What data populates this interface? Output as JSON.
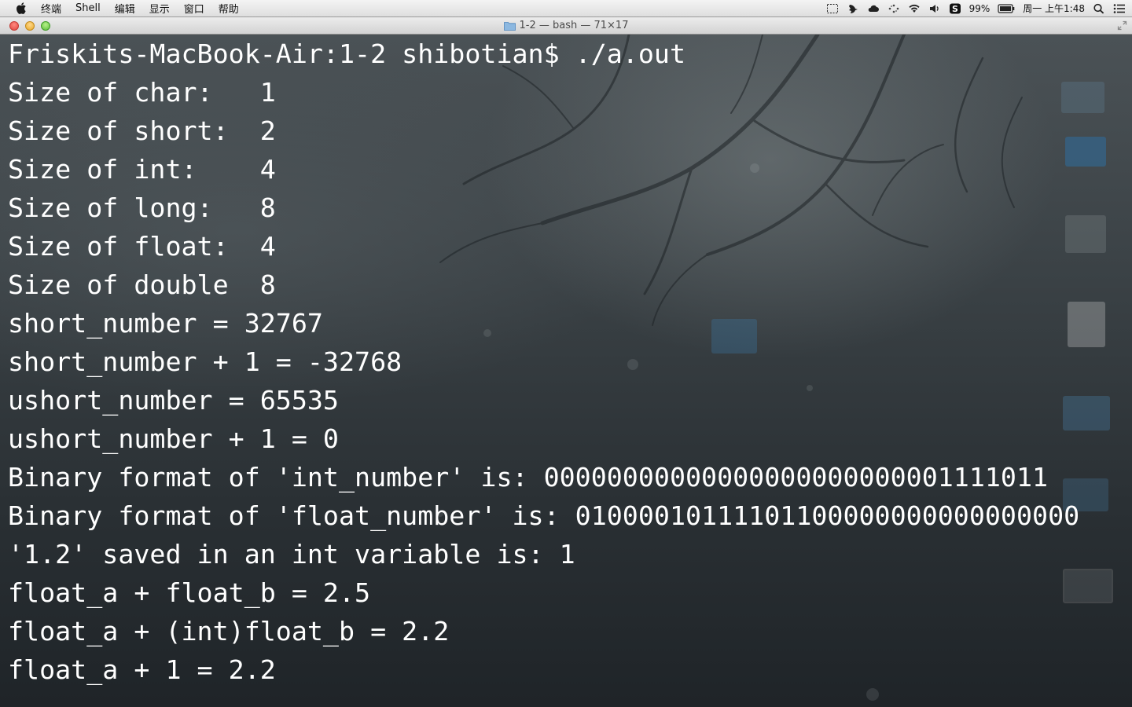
{
  "menubar": {
    "apple_icon": "apple-logo-icon",
    "items": [
      "终端",
      "Shell",
      "编辑",
      "显示",
      "窗口",
      "帮助"
    ],
    "status": {
      "battery_percent": "99%",
      "clock": "周一 上午1:48",
      "icons": [
        "screen-capture-icon",
        "bird-icon",
        "cloud-icon",
        "dots-icon",
        "wifi-icon",
        "volume-icon",
        "s-badge-icon",
        "battery-icon",
        "spotlight-search-icon",
        "notification-list-icon"
      ]
    }
  },
  "window": {
    "title": "1-2 — bash — 71×17"
  },
  "terminal": {
    "lines": [
      "Friskits-MacBook-Air:1-2 shibotian$ ./a.out",
      "Size of char:   1",
      "Size of short:  2",
      "Size of int:    4",
      "Size of long:   8",
      "Size of float:  4",
      "Size of double  8",
      "short_number = 32767",
      "short_number + 1 = -32768",
      "ushort_number = 65535",
      "ushort_number + 1 = 0",
      "Binary format of 'int_number' is: 00000000000000000000000001111011",
      "Binary format of 'float_number' is: 01000010111101100000000000000000",
      "'1.2' saved in an int variable is: 1",
      "float_a + float_b = 2.5",
      "float_a + (int)float_b = 2.2",
      "float_a + 1 = 2.2"
    ]
  }
}
